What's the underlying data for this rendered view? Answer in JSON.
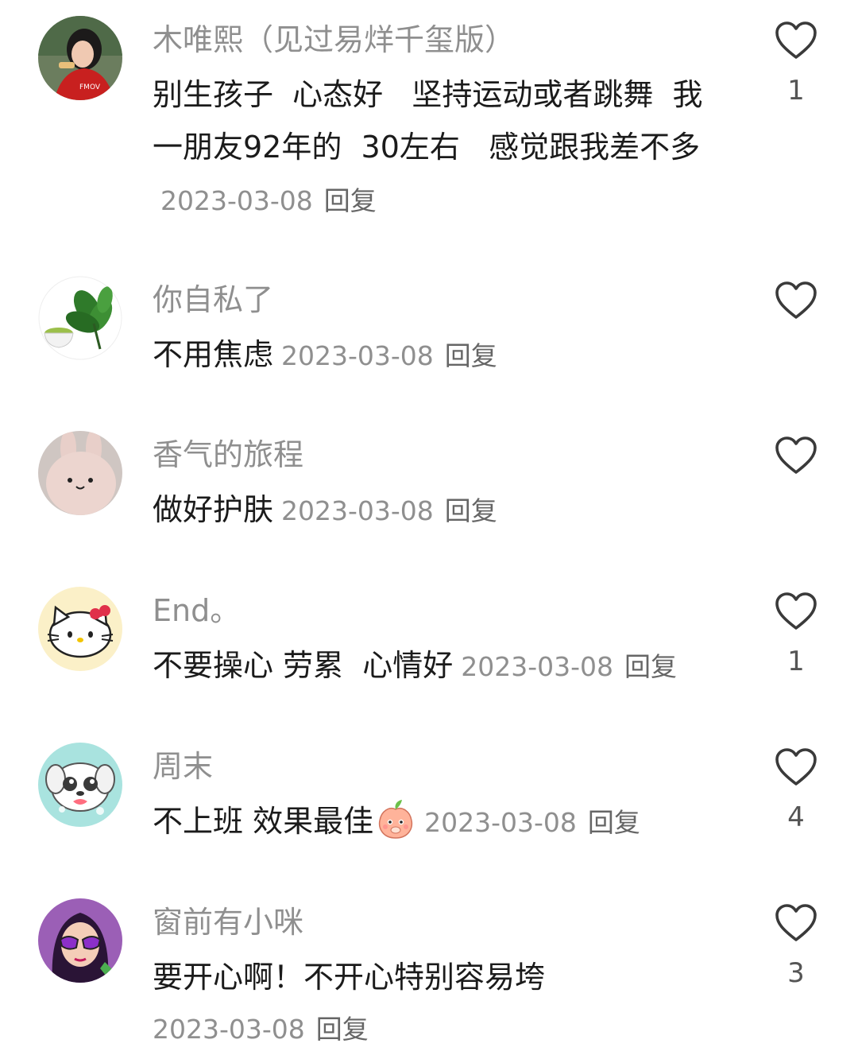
{
  "comments": [
    {
      "username": "木唯熙（见过易烊千玺版）",
      "text": "别生孩子  心态好   坚持运动或者跳舞  我一朋友92年的  30左右   感觉跟我差不多",
      "date": "2023-03-08",
      "reply": "回复",
      "likes": "1",
      "avatar_icon": "avatar-woman-photo-icon"
    },
    {
      "username": "你自私了",
      "text": "不用焦虑",
      "date": "2023-03-08",
      "reply": "回复",
      "likes": "",
      "avatar_icon": "avatar-tea-leaves-icon"
    },
    {
      "username": "香气的旅程",
      "text": "做好护肤",
      "date": "2023-03-08",
      "reply": "回复",
      "likes": "",
      "avatar_icon": "avatar-bunny-plush-icon"
    },
    {
      "username": "End。",
      "text": "不要操心 劳累  心情好",
      "date": "2023-03-08",
      "reply": "回复",
      "likes": "1",
      "avatar_icon": "avatar-hello-kitty-icon"
    },
    {
      "username": "周末",
      "text": "不上班 效果最佳",
      "emoji": "peach-emoji-icon",
      "date": "2023-03-08",
      "reply": "回复",
      "likes": "4",
      "avatar_icon": "avatar-puppy-cartoon-icon"
    },
    {
      "username": "窗前有小咪",
      "text": "要开心啊！不开心特别容易垮",
      "date": "2023-03-08",
      "reply": "回复",
      "likes": "3",
      "avatar_icon": "avatar-girl-sunglasses-icon"
    }
  ],
  "colors": {
    "username": "#8f8f8f",
    "text": "#1b1b1b",
    "meta": "#8f8f8f",
    "heart_stroke": "#3a3a3a"
  }
}
